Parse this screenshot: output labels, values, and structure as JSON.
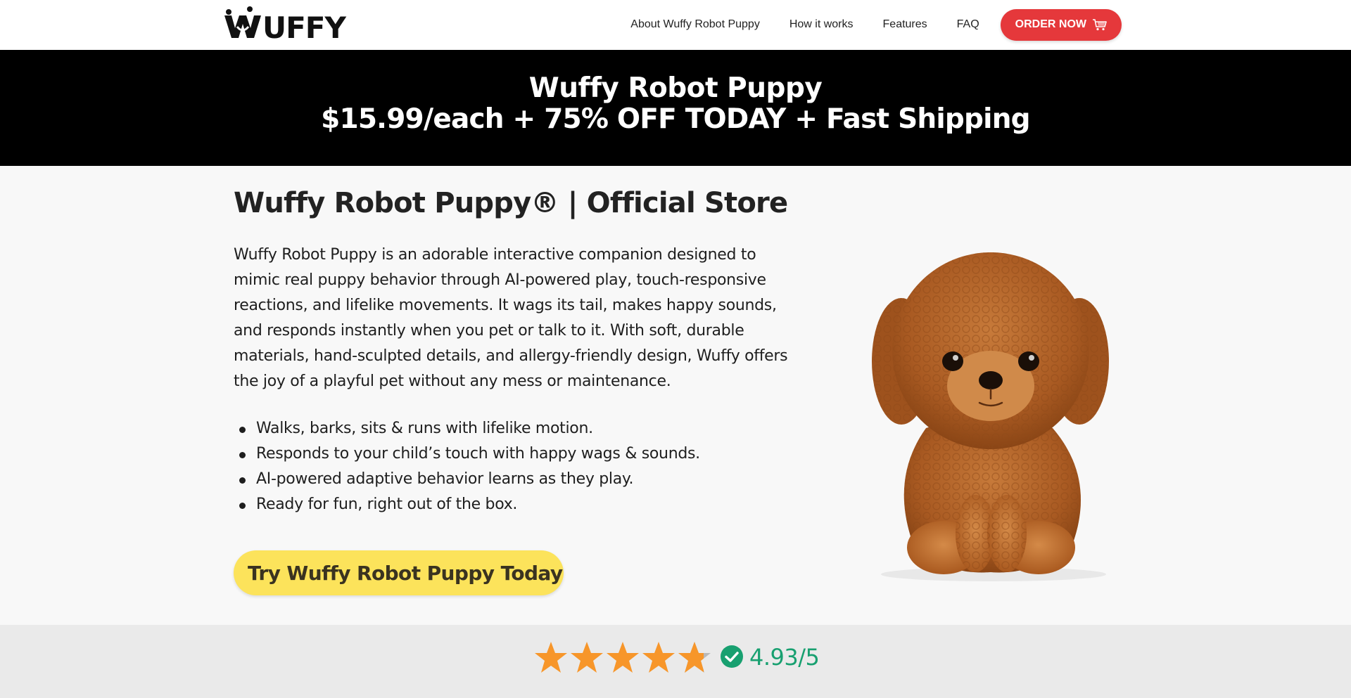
{
  "brand": {
    "logo_text": "WUFFY"
  },
  "nav": {
    "links": [
      "About Wuffy Robot Puppy",
      "How it works",
      "Features",
      "FAQ"
    ],
    "order_label": "ORDER NOW"
  },
  "promo": {
    "line1": "Wuffy Robot Puppy",
    "line2": "$15.99/each + 75% OFF TODAY + Fast Shipping"
  },
  "main": {
    "title": "Wuffy Robot Puppy® | Official Store",
    "description": "Wuffy Robot Puppy is an adorable interactive companion designed to mimic real puppy behavior through AI-powered play, touch-responsive reactions, and lifelike movements. It wags its tail, makes happy sounds, and responds instantly when you pet or talk to it. With soft, durable materials, hand-sculpted details, and allergy-friendly design, Wuffy offers the joy of a playful pet without any mess or maintenance.",
    "bullets": [
      "Walks, barks, sits & runs with lifelike motion.",
      "Responds to your child’s touch with happy wags & sounds.",
      "AI-powered adaptive behavior learns as they play.",
      "Ready for fun, right out of the box."
    ],
    "cta_label": "Try Wuffy Robot Puppy Today"
  },
  "rating": {
    "score_text": "4.93/5",
    "stars_filled": 4.93,
    "stars_total": 5
  },
  "colors": {
    "order_button": "#e5383b",
    "cta_button": "#fce35b",
    "promo_bg": "#000000",
    "star": "#f7962a",
    "rating_green": "#18a070"
  },
  "icons": [
    "cart-icon",
    "chevron-right-icon",
    "star-icon",
    "verified-check-icon",
    "puppy-image"
  ]
}
